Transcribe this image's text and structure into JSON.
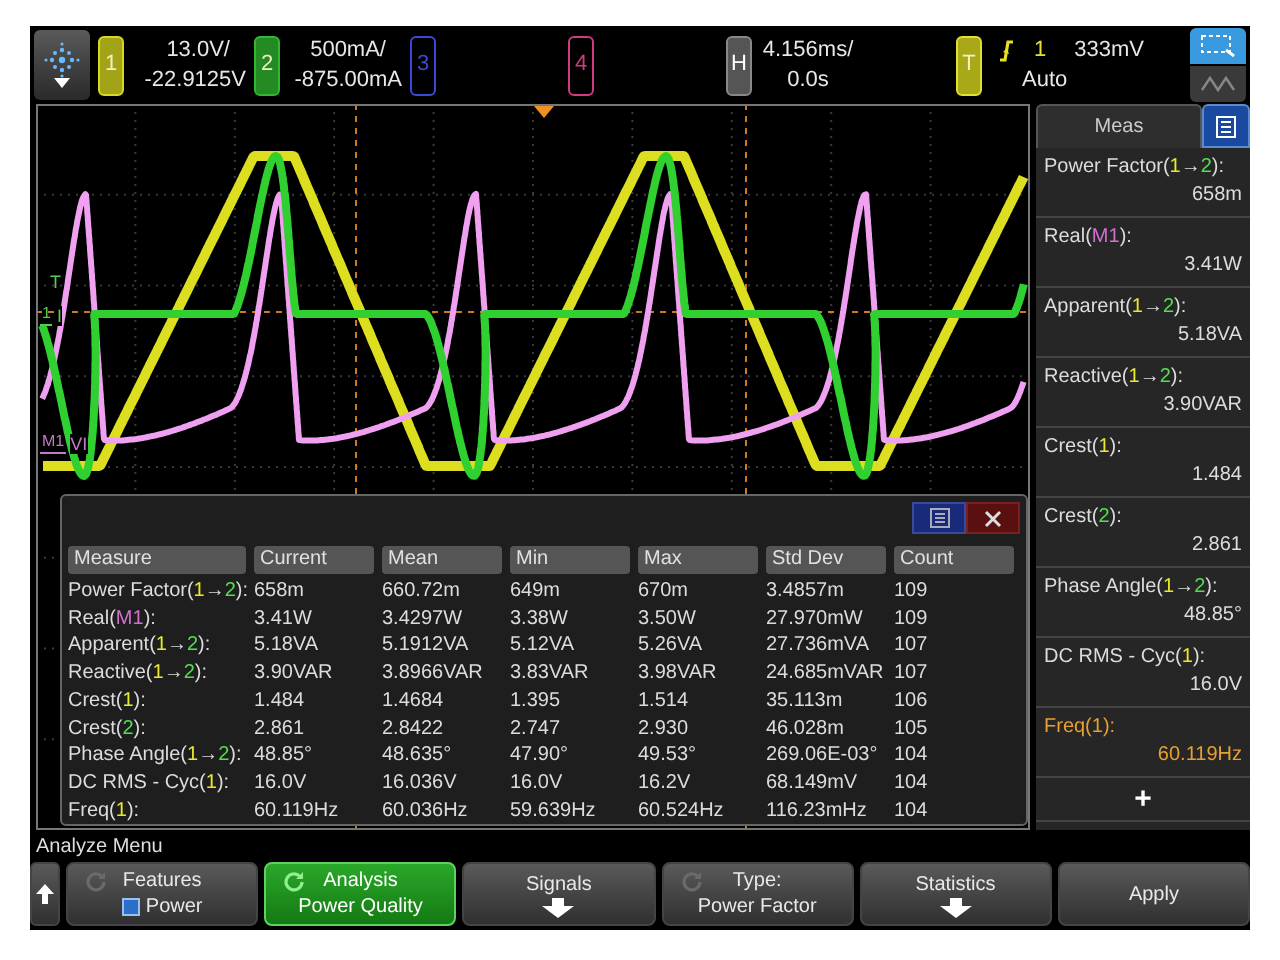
{
  "top_bar": {
    "channels": [
      {
        "number": "1",
        "color": "#d8d820",
        "on": true,
        "scale": "13.0V/",
        "offset": "-22.9125V"
      },
      {
        "number": "2",
        "color": "#30b830",
        "on": true,
        "scale": "500mA/",
        "offset": "-875.00mA"
      },
      {
        "number": "3",
        "color": "#3a4ad8",
        "on": false
      },
      {
        "number": "4",
        "color": "#d03a80",
        "on": false
      }
    ],
    "horizontal": {
      "label": "H",
      "scale": "4.156ms/",
      "delay": "0.0s"
    },
    "trigger": {
      "label": "T",
      "source": "1",
      "level": "333mV",
      "mode": "Auto"
    }
  },
  "plot": {
    "trigger_mark": "T",
    "markers": [
      {
        "label": "1",
        "tag": "I",
        "color": "#50d050"
      },
      {
        "label": "M1",
        "tag": "VI",
        "color": "#c878c8"
      }
    ]
  },
  "table": {
    "columns": [
      "Measure",
      "Current",
      "Mean",
      "Min",
      "Max",
      "Std Dev",
      "Count"
    ],
    "rows": [
      {
        "cells": [
          [
            {
              "text": "Power Factor("
            },
            {
              "text": "1",
              "color": "#e8e830"
            },
            {
              "text": "→"
            },
            {
              "text": "2",
              "color": "#50e050"
            },
            {
              "text": "):"
            }
          ],
          "658m",
          "660.72m",
          "649m",
          "670m",
          "3.4857m",
          "109"
        ]
      },
      {
        "cells": [
          [
            {
              "text": "Real("
            },
            {
              "text": "M1",
              "color": "#d070d0"
            },
            {
              "text": "):"
            }
          ],
          "3.41W",
          "3.4297W",
          "3.38W",
          "3.50W",
          "27.970mW",
          "109"
        ]
      },
      {
        "cells": [
          [
            {
              "text": "Apparent("
            },
            {
              "text": "1",
              "color": "#e8e830"
            },
            {
              "text": "→"
            },
            {
              "text": "2",
              "color": "#50e050"
            },
            {
              "text": "):"
            }
          ],
          "5.18VA",
          "5.1912VA",
          "5.12VA",
          "5.26VA",
          "27.736mVA",
          "107"
        ]
      },
      {
        "cells": [
          [
            {
              "text": "Reactive("
            },
            {
              "text": "1",
              "color": "#e8e830"
            },
            {
              "text": "→"
            },
            {
              "text": "2",
              "color": "#50e050"
            },
            {
              "text": "):"
            }
          ],
          "3.90VAR",
          "3.8966VAR",
          "3.83VAR",
          "3.98VAR",
          "24.685mVAR",
          "107"
        ]
      },
      {
        "cells": [
          [
            {
              "text": "Crest("
            },
            {
              "text": "1",
              "color": "#e8e830"
            },
            {
              "text": "):"
            }
          ],
          "1.484",
          "1.4684",
          "1.395",
          "1.514",
          "35.113m",
          "106"
        ]
      },
      {
        "cells": [
          [
            {
              "text": "Crest("
            },
            {
              "text": "2",
              "color": "#50e050"
            },
            {
              "text": "):"
            }
          ],
          "2.861",
          "2.8422",
          "2.747",
          "2.930",
          "46.028m",
          "105"
        ]
      },
      {
        "cells": [
          [
            {
              "text": "Phase Angle("
            },
            {
              "text": "1",
              "color": "#e8e830"
            },
            {
              "text": "→"
            },
            {
              "text": "2",
              "color": "#50e050"
            },
            {
              "text": "):"
            }
          ],
          "48.85°",
          "48.635°",
          "47.90°",
          "49.53°",
          "269.06E-03°",
          "104"
        ]
      },
      {
        "cells": [
          [
            {
              "text": "DC RMS - Cyc("
            },
            {
              "text": "1",
              "color": "#e8e830"
            },
            {
              "text": "):"
            }
          ],
          "16.0V",
          "16.036V",
          "16.0V",
          "16.2V",
          "68.149mV",
          "104"
        ]
      },
      {
        "cells": [
          [
            {
              "text": "Freq("
            },
            {
              "text": "1",
              "color": "#e8e830"
            },
            {
              "text": "):"
            }
          ],
          "60.119Hz",
          "60.036Hz",
          "59.639Hz",
          "60.524Hz",
          "116.23mHz",
          "104"
        ]
      }
    ]
  },
  "panel": {
    "tab": "Meas",
    "items": [
      {
        "label": [
          {
            "text": "Power Factor("
          },
          {
            "text": "1",
            "color": "#e8e830"
          },
          {
            "text": "→"
          },
          {
            "text": "2",
            "color": "#50e050"
          },
          {
            "text": "):"
          }
        ],
        "value": "658m",
        "selected": false
      },
      {
        "label": [
          {
            "text": "Real("
          },
          {
            "text": "M1",
            "color": "#d070d0"
          },
          {
            "text": "):"
          }
        ],
        "value": "3.41W",
        "selected": false
      },
      {
        "label": [
          {
            "text": "Apparent("
          },
          {
            "text": "1",
            "color": "#e8e830"
          },
          {
            "text": "→"
          },
          {
            "text": "2",
            "color": "#50e050"
          },
          {
            "text": "):"
          }
        ],
        "value": "5.18VA",
        "selected": false
      },
      {
        "label": [
          {
            "text": "Reactive("
          },
          {
            "text": "1",
            "color": "#e8e830"
          },
          {
            "text": "→"
          },
          {
            "text": "2",
            "color": "#50e050"
          },
          {
            "text": "):"
          }
        ],
        "value": "3.90VAR",
        "selected": false
      },
      {
        "label": [
          {
            "text": "Crest("
          },
          {
            "text": "1",
            "color": "#e8e830"
          },
          {
            "text": "):"
          }
        ],
        "value": "1.484",
        "selected": false
      },
      {
        "label": [
          {
            "text": "Crest("
          },
          {
            "text": "2",
            "color": "#50e050"
          },
          {
            "text": "):"
          }
        ],
        "value": "2.861",
        "selected": false
      },
      {
        "label": [
          {
            "text": "Phase Angle("
          },
          {
            "text": "1",
            "color": "#e8e830"
          },
          {
            "text": "→"
          },
          {
            "text": "2",
            "color": "#50e050"
          },
          {
            "text": "):"
          }
        ],
        "value": "48.85°",
        "selected": false
      },
      {
        "label": [
          {
            "text": "DC RMS - Cyc("
          },
          {
            "text": "1",
            "color": "#e8e830"
          },
          {
            "text": "):"
          }
        ],
        "value": "16.0V",
        "selected": false
      },
      {
        "label": [
          {
            "text": "Freq(1):"
          }
        ],
        "value": "60.119Hz",
        "selected": true
      }
    ],
    "add_button": "+"
  },
  "menu_title": "Analyze Menu",
  "softkeys": [
    {
      "kind": "up",
      "selected": false
    },
    {
      "kind": "toggle",
      "title": "Features",
      "value": "Power",
      "checked": true,
      "selected": false
    },
    {
      "kind": "choice",
      "title": "Analysis",
      "value": "Power Quality",
      "selected": true
    },
    {
      "kind": "submenu",
      "title": "Signals",
      "selected": false
    },
    {
      "kind": "choice",
      "title": "Type:",
      "value": "Power Factor",
      "selected": false
    },
    {
      "kind": "submenu",
      "title": "Statistics",
      "selected": false
    },
    {
      "kind": "action",
      "title": "Apply",
      "selected": false
    }
  ]
}
